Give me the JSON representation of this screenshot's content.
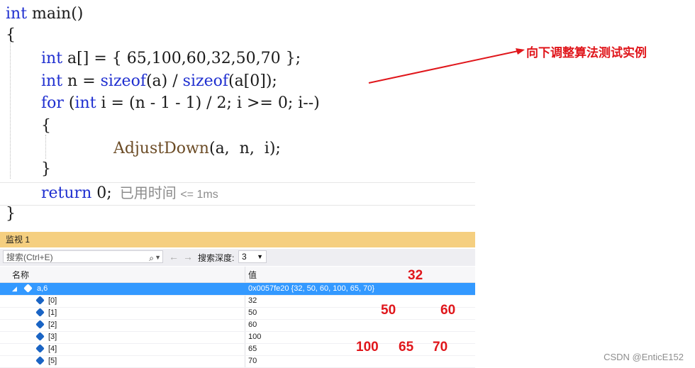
{
  "code": {
    "line1": {
      "kw": "int",
      "text": " main()"
    },
    "line2": "{",
    "line3": {
      "kw": "int",
      "text": " a[] = { 65,100,60,32,50,70 };"
    },
    "line4": {
      "kw": "int",
      "t1": " n = ",
      "fn1": "sizeof",
      "t2": "(a) / ",
      "fn2": "sizeof",
      "t3": "(a[0]);"
    },
    "line5": {
      "kw1": "for",
      "t1": " (",
      "kw2": "int",
      "t2": " i = (n - 1 - 1) / 2; i >= 0; i--)"
    },
    "line6": "{",
    "line7": {
      "fn": "AdjustDown",
      "text": "(a,  n,  i);"
    },
    "line8": "}",
    "line9": {
      "kw": "return",
      "text": " 0;",
      "perf_label": "已用时间",
      "perf_value": "<= 1ms"
    },
    "line10": "}"
  },
  "annotation": "向下调整算法测试实例",
  "colors": {
    "keyword": "#1f2fd0",
    "annotation": "#e0161b",
    "watch_header": "#f5cf80",
    "selection": "#3399ff"
  },
  "watch": {
    "title": "监视 1",
    "search_placeholder": "搜索(Ctrl+E)",
    "search_icon": "search-icon",
    "depth_label": "搜索深度:",
    "depth_value": "3",
    "header_name": "名称",
    "header_value": "值",
    "root": {
      "name": "a,6",
      "value": "0x0057fe20 {32, 50, 60, 100, 65, 70}"
    },
    "items": [
      {
        "name": "[0]",
        "value": "32"
      },
      {
        "name": "[1]",
        "value": "50"
      },
      {
        "name": "[2]",
        "value": "60"
      },
      {
        "name": "[3]",
        "value": "100"
      },
      {
        "name": "[4]",
        "value": "65"
      },
      {
        "name": "[5]",
        "value": "70"
      }
    ]
  },
  "heap_labels": {
    "l0": "32",
    "l1": "50",
    "l2": "60",
    "l3": "100",
    "l4": "65",
    "l5": "70"
  },
  "watermark": "CSDN @EnticE152"
}
